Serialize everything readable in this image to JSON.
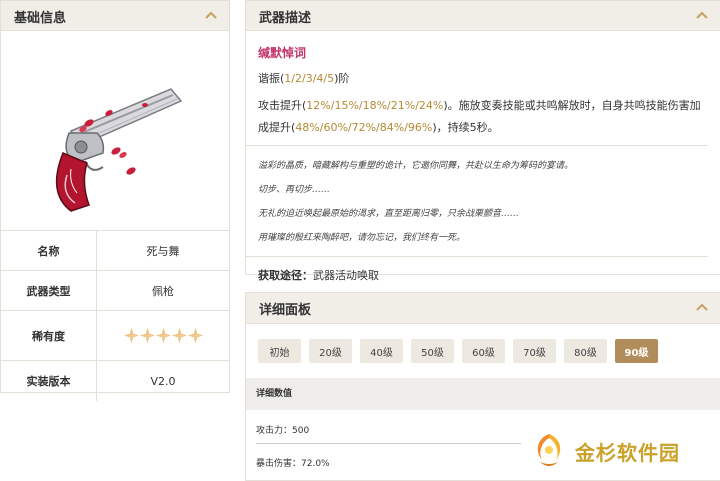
{
  "left": {
    "title": "基础信息",
    "rows": [
      {
        "label": "名称",
        "value": "死与舞"
      },
      {
        "label": "武器类型",
        "value": "佩枪"
      },
      {
        "label": "稀有度",
        "stars": 5
      },
      {
        "label": "实装版本",
        "value": "V2.0"
      }
    ]
  },
  "desc": {
    "title": "武器描述",
    "name": "缄默悼词",
    "resonance_prefix": "谐振(",
    "resonance_values": "1/2/3/4/5",
    "resonance_suffix": ")阶",
    "skill_a": "攻击提升(",
    "skill_b": "12%/15%/18%/21%/24%",
    "skill_c": ")。施放变奏技能或共鸣解放时，自身共鸣技能伤害加成提升(",
    "skill_d": "48%/60%/72%/84%/96%",
    "skill_e": ")，持续5秒。",
    "story": [
      "溢彩的晶质，暗藏解构与重塑的诡计，它邀你同舞，共赴以生命为筹码的宴请。",
      "切步、再切步……",
      "无礼的迫近唤起最原始的渴求，直至距离归零，只余战栗颤音……",
      "用璀璨的殷红来陶醉吧，请勿忘记，我们终有一死。"
    ],
    "source_label": "获取途径：",
    "source_value": "武器活动唤取"
  },
  "detail": {
    "title": "详细面板",
    "levels": [
      "初始",
      "20级",
      "40级",
      "50级",
      "60级",
      "70级",
      "80级",
      "90级"
    ],
    "active_level": "90级",
    "stat_header": "详细数值",
    "stat_atk": "攻击力：500",
    "stat_crit": "暴击伤害：72.0%"
  },
  "watermark": "金杉软件园",
  "colors": {
    "accent": "#b08d5a",
    "name": "#c2366b",
    "highlight": "#b58a35",
    "header_bg": "#f1eee8"
  }
}
